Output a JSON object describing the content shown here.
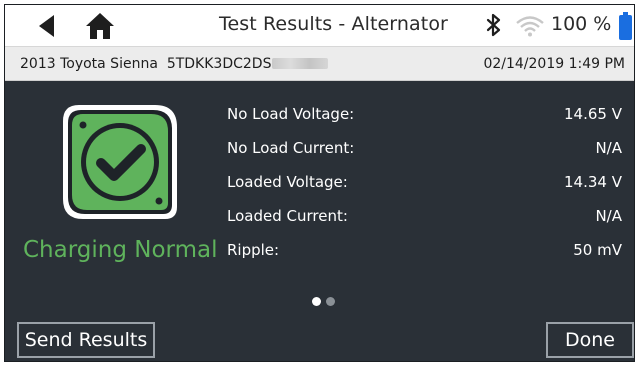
{
  "header": {
    "title": "Test Results - Alternator",
    "battery_percent": "100 %",
    "icons": [
      "back-arrow-icon",
      "home-icon",
      "bluetooth-icon",
      "wifi-icon",
      "battery-icon"
    ]
  },
  "vehicle": {
    "description": "2013 Toyota Sienna",
    "vin_visible": "5TDKK3DC2DS",
    "datetime": "02/14/2019 1:49 PM"
  },
  "status": {
    "label": "Charging Normal",
    "icon": "check-badge-icon",
    "color": "#5fb35c"
  },
  "results": [
    {
      "label": "No Load Voltage:",
      "value": "14.65 V"
    },
    {
      "label": "No Load Current:",
      "value": "N/A"
    },
    {
      "label": "Loaded Voltage:",
      "value": "14.34 V"
    },
    {
      "label": "Loaded Current:",
      "value": "N/A"
    },
    {
      "label": "Ripple:",
      "value": "50 mV"
    }
  ],
  "pager": {
    "pages": 2,
    "current": 1
  },
  "buttons": {
    "send_results": "Send Results",
    "done": "Done"
  },
  "colors": {
    "accent": "#5fb35c",
    "battery": "#1a6ee0",
    "background": "#2a3037"
  }
}
